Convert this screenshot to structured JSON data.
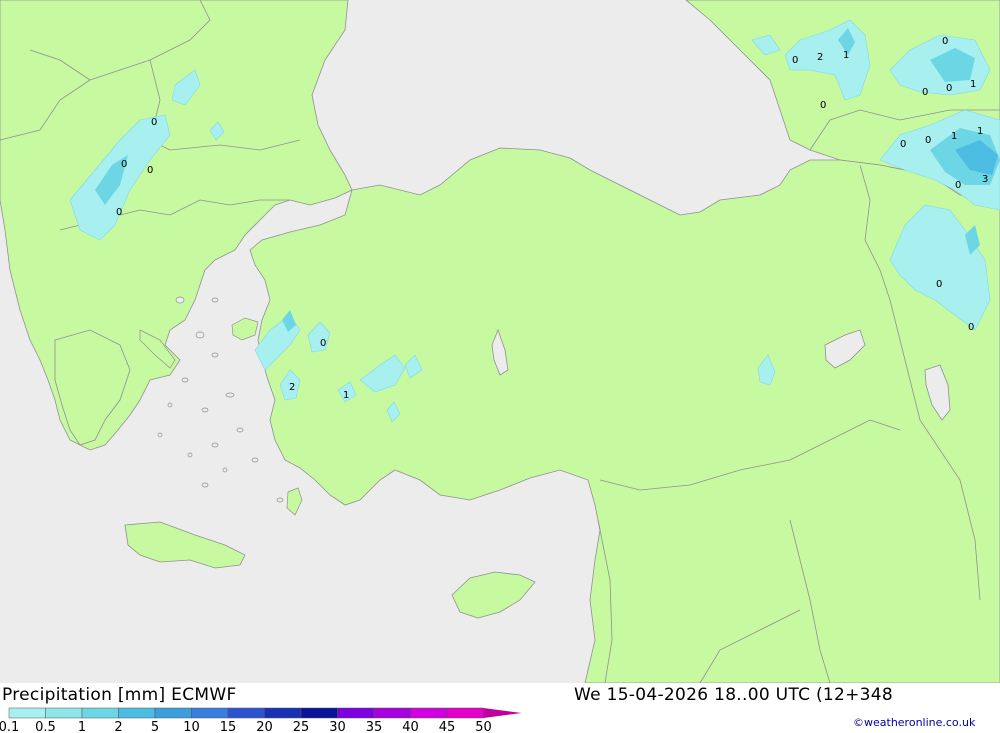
{
  "map": {
    "region": "Turkey, Greece, Caucasus, Cyprus",
    "sea_color": "#ececec",
    "land_color": "#c7f9a1",
    "border_color": "#909090",
    "point_values": [
      {
        "id": "ne1",
        "text": "0"
      },
      {
        "id": "ne2",
        "text": "2"
      },
      {
        "id": "ne3",
        "text": "1"
      },
      {
        "id": "ne4",
        "text": "0"
      },
      {
        "id": "ne5",
        "text": "0"
      },
      {
        "id": "ne6",
        "text": "0"
      },
      {
        "id": "ne7",
        "text": "1"
      },
      {
        "id": "ne8",
        "text": "0"
      },
      {
        "id": "ne9",
        "text": "0"
      },
      {
        "id": "ne10",
        "text": "0"
      },
      {
        "id": "ne11",
        "text": "1"
      },
      {
        "id": "ne12",
        "text": "1"
      },
      {
        "id": "ne13",
        "text": "0"
      },
      {
        "id": "ne14",
        "text": "3"
      },
      {
        "id": "ne15",
        "text": "0"
      },
      {
        "id": "ne16",
        "text": "0"
      },
      {
        "id": "gr1",
        "text": "0"
      },
      {
        "id": "gr2",
        "text": "0"
      },
      {
        "id": "gr3",
        "text": "0"
      },
      {
        "id": "gr4",
        "text": "0"
      },
      {
        "id": "tr1",
        "text": "0"
      },
      {
        "id": "tr2",
        "text": "2"
      },
      {
        "id": "tr3",
        "text": "1"
      }
    ]
  },
  "footer": {
    "title": "Precipitation [mm] ECMWF",
    "date": "We 15-04-2026 18..00 UTC (12+348",
    "credit": "©weatheronline.co.uk"
  },
  "legend": {
    "colors": [
      "#a8f0f0",
      "#8ee6ea",
      "#6cd6e4",
      "#4cbce2",
      "#3c9edc",
      "#3a7ce0",
      "#2c54d0",
      "#1830b4",
      "#08129a",
      "#7d00e0",
      "#a600e0",
      "#d000e0",
      "#e400c8",
      "#c0009c"
    ],
    "ticks": [
      "0.1",
      "0.5",
      "1",
      "2",
      "5",
      "10",
      "15",
      "20",
      "25",
      "30",
      "35",
      "40",
      "45",
      "50"
    ]
  }
}
